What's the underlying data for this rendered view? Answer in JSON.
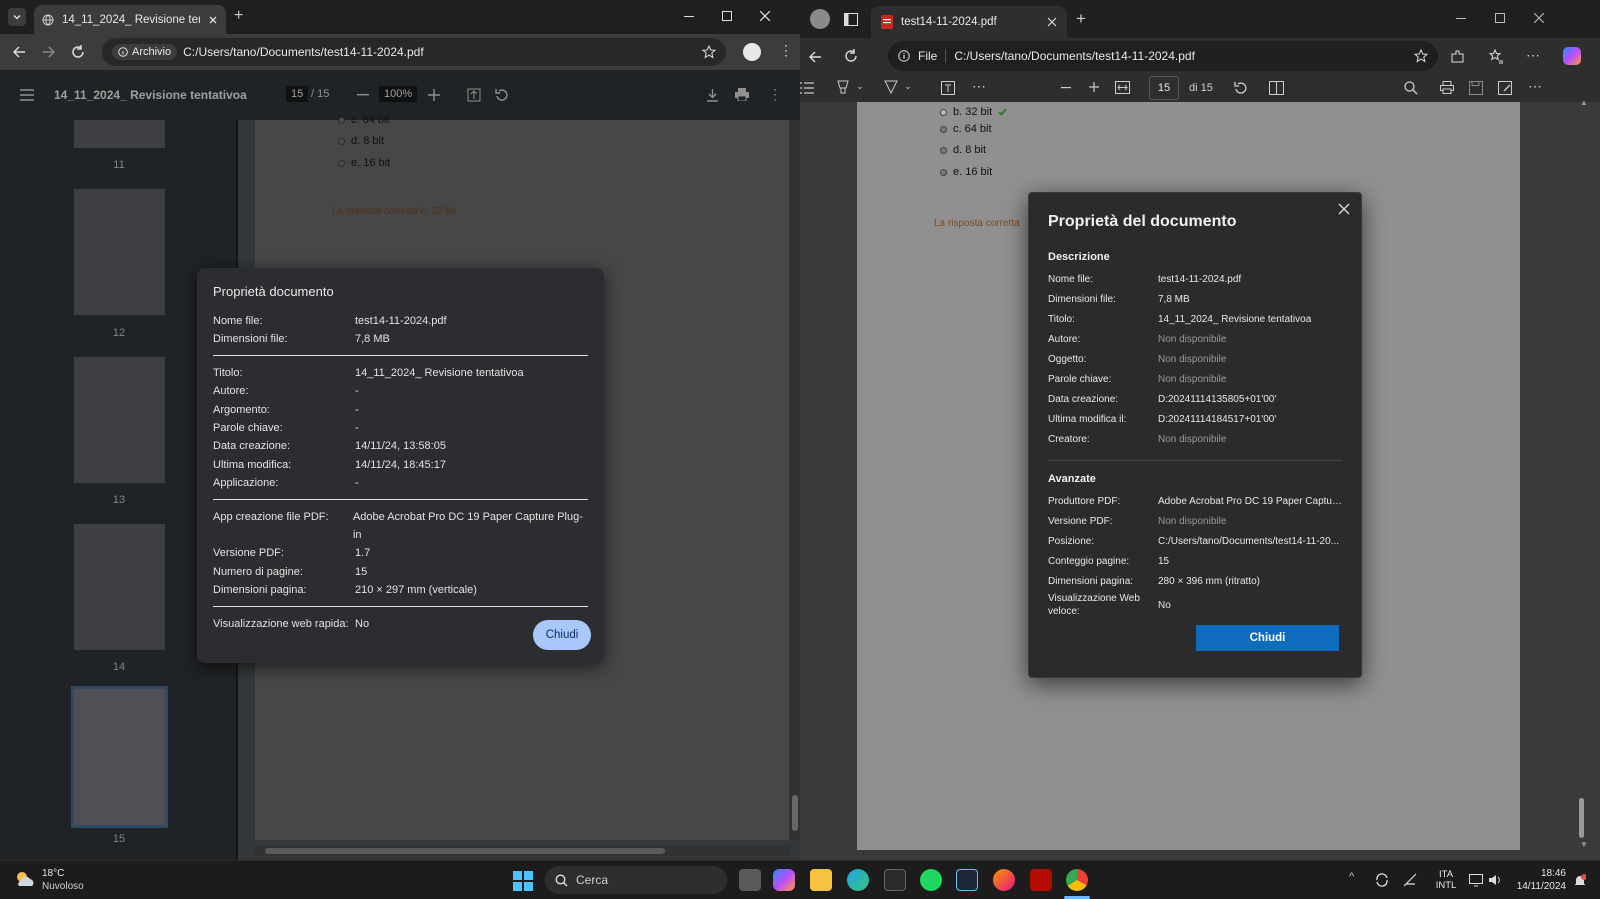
{
  "left_browser": {
    "tab_title": "14_11_2024_ Revisione tentativ",
    "omnibox_chip": "Archivio",
    "url": "C:/Users/tano/Documents/test14-11-2024.pdf",
    "pdf_title": "14_11_2024_ Revisione tentativoa",
    "page_current": "15",
    "page_total": "/ 15",
    "zoom": "100%",
    "thumbnail_labels": [
      "11",
      "12",
      "13",
      "14",
      "15"
    ],
    "page_options": [
      "c.  64 bit",
      "d.  8 bit",
      "e.  16 bit"
    ],
    "answer_text": "La risposta corretta è: 32 bit",
    "dialog": {
      "title": "Proprietà documento",
      "group1": [
        {
          "k": "Nome file:",
          "v": "test14-11-2024.pdf"
        },
        {
          "k": "Dimensioni file:",
          "v": "7,8 MB"
        }
      ],
      "group2": [
        {
          "k": "Titolo:",
          "v": "14_11_2024_ Revisione tentativoa"
        },
        {
          "k": "Autore:",
          "v": "-"
        },
        {
          "k": "Argomento:",
          "v": "-"
        },
        {
          "k": "Parole chiave:",
          "v": "-"
        },
        {
          "k": "Data creazione:",
          "v": "14/11/24, 13:58:05"
        },
        {
          "k": "Ultima modifica:",
          "v": "14/11/24, 18:45:17"
        },
        {
          "k": "Applicazione:",
          "v": "-"
        }
      ],
      "group3": [
        {
          "k": "App creazione file PDF:",
          "v": "Adobe Acrobat Pro DC 19 Paper Capture Plug-in"
        },
        {
          "k": "Versione PDF:",
          "v": "1.7"
        },
        {
          "k": "Numero di pagine:",
          "v": "15"
        },
        {
          "k": "Dimensioni pagina:",
          "v": "210 × 297 mm (verticale)"
        }
      ],
      "group4": [
        {
          "k": "Visualizzazione web rapida:",
          "v": "No"
        }
      ],
      "close_label": "Chiudi"
    }
  },
  "right_browser": {
    "tab_title": "test14-11-2024.pdf",
    "omnibox_chip": "File",
    "url": "C:/Users/tano/Documents/test14-11-2024.pdf",
    "page_current": "15",
    "page_total": "di 15",
    "page_options": [
      "b.  32 bit",
      "c.  64 bit",
      "d.  8 bit",
      "e.  16 bit"
    ],
    "answer_text": "La risposta corretta",
    "dialog": {
      "title": "Proprietà del documento",
      "section_description": "Descrizione",
      "description": [
        {
          "k": "Nome file:",
          "v": "test14-11-2024.pdf",
          "na": false
        },
        {
          "k": "Dimensioni file:",
          "v": "7,8 MB",
          "na": false
        },
        {
          "k": "Titolo:",
          "v": "14_11_2024_ Revisione tentativoa",
          "na": false
        },
        {
          "k": "Autore:",
          "v": "Non disponibile",
          "na": true
        },
        {
          "k": "Oggetto:",
          "v": "Non disponibile",
          "na": true
        },
        {
          "k": "Parole chiave:",
          "v": "Non disponibile",
          "na": true
        },
        {
          "k": "Data creazione:",
          "v": "D:20241114135805+01'00'",
          "na": false
        },
        {
          "k": "Ultima modifica il:",
          "v": "D:20241114184517+01'00'",
          "na": false
        },
        {
          "k": "Creatore:",
          "v": "Non disponibile",
          "na": true
        }
      ],
      "section_advanced": "Avanzate",
      "advanced": [
        {
          "k": "Produttore PDF:",
          "v": "Adobe Acrobat Pro DC 19 Paper Captur...",
          "na": false
        },
        {
          "k": "Versione PDF:",
          "v": "Non disponibile",
          "na": true
        },
        {
          "k": "Posizione:",
          "v": "C:/Users/tano/Documents/test14-11-20...",
          "na": false
        },
        {
          "k": "Conteggio pagine:",
          "v": "15",
          "na": false
        },
        {
          "k": "Dimensioni pagina:",
          "v": "280 × 396 mm (ritratto)",
          "na": false
        }
      ],
      "fast_web_label": "Visualizzazione Web veloce:",
      "fast_web_value": "No",
      "close_label": "Chiudi"
    }
  },
  "taskbar": {
    "weather_temp": "18°C",
    "weather_desc": "Nuvoloso",
    "search_placeholder": "Cerca",
    "lang_1": "ITA",
    "lang_2": "INTL",
    "time": "18:46",
    "date": "14/11/2024"
  },
  "colors": {
    "chrome_close_btn": "#a8c7fa",
    "edge_close_btn": "#0f6cbd",
    "answer_text": "#7a4a1e"
  }
}
